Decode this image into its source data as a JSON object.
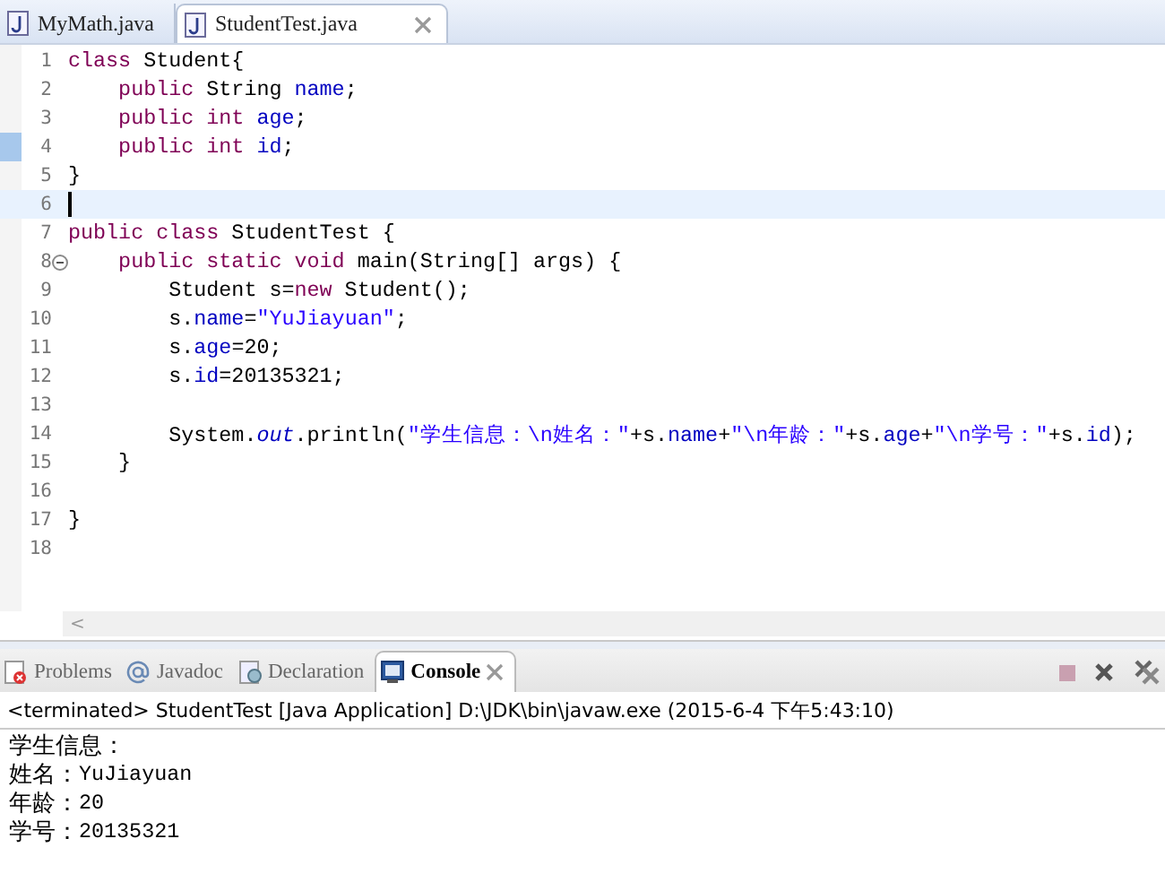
{
  "editor_tabs": [
    {
      "label": "MyMath.java",
      "selected": false,
      "closable": false
    },
    {
      "label": "StudentTest.java",
      "selected": true,
      "closable": true
    }
  ],
  "code_lines": [
    {
      "number": "1",
      "current": false,
      "marked": false,
      "foldable": false,
      "tokens": [
        {
          "kind": "keyword",
          "text": "class"
        },
        {
          "kind": "plain",
          "text": " Student{"
        }
      ]
    },
    {
      "number": "2",
      "current": false,
      "marked": false,
      "foldable": false,
      "tokens": [
        {
          "kind": "keyword",
          "text": "    public"
        },
        {
          "kind": "plain",
          "text": " String "
        },
        {
          "kind": "field",
          "text": "name"
        },
        {
          "kind": "plain",
          "text": ";"
        }
      ]
    },
    {
      "number": "3",
      "current": false,
      "marked": false,
      "foldable": false,
      "tokens": [
        {
          "kind": "keyword",
          "text": "    public int"
        },
        {
          "kind": "field",
          "text": " age"
        },
        {
          "kind": "plain",
          "text": ";"
        }
      ]
    },
    {
      "number": "4",
      "current": false,
      "marked": true,
      "foldable": false,
      "tokens": [
        {
          "kind": "keyword",
          "text": "    public int"
        },
        {
          "kind": "field",
          "text": " id"
        },
        {
          "kind": "plain",
          "text": ";"
        }
      ]
    },
    {
      "number": "5",
      "current": false,
      "marked": false,
      "foldable": false,
      "tokens": [
        {
          "kind": "plain",
          "text": "}"
        }
      ]
    },
    {
      "number": "6",
      "current": true,
      "marked": false,
      "foldable": false
    },
    {
      "number": "7",
      "current": false,
      "marked": false,
      "foldable": false,
      "tokens": [
        {
          "kind": "keyword",
          "text": "public class"
        },
        {
          "kind": "plain",
          "text": " StudentTest {"
        }
      ]
    },
    {
      "number": "8",
      "current": false,
      "marked": false,
      "foldable": true,
      "tokens": [
        {
          "kind": "keyword",
          "text": "    public static void"
        },
        {
          "kind": "plain",
          "text": " main(String[] args) {"
        }
      ]
    },
    {
      "number": "9",
      "current": false,
      "marked": false,
      "foldable": false,
      "tokens": [
        {
          "kind": "plain",
          "text": "        Student s="
        },
        {
          "kind": "keyword",
          "text": "new"
        },
        {
          "kind": "plain",
          "text": " Student();"
        }
      ]
    },
    {
      "number": "10",
      "current": false,
      "marked": false,
      "foldable": false,
      "tokens": [
        {
          "kind": "plain",
          "text": "        s."
        },
        {
          "kind": "field",
          "text": "name"
        },
        {
          "kind": "plain",
          "text": "="
        },
        {
          "kind": "string",
          "text": "\"YuJiayuan\""
        },
        {
          "kind": "plain",
          "text": ";"
        }
      ]
    },
    {
      "number": "11",
      "current": false,
      "marked": false,
      "foldable": false,
      "tokens": [
        {
          "kind": "plain",
          "text": "        s."
        },
        {
          "kind": "field",
          "text": "age"
        },
        {
          "kind": "plain",
          "text": "=20;"
        }
      ]
    },
    {
      "number": "12",
      "current": false,
      "marked": false,
      "foldable": false,
      "tokens": [
        {
          "kind": "plain",
          "text": "        s."
        },
        {
          "kind": "field",
          "text": "id"
        },
        {
          "kind": "plain",
          "text": "=20135321;"
        }
      ]
    },
    {
      "number": "13",
      "current": false,
      "marked": false,
      "foldable": false
    },
    {
      "number": "14",
      "current": false,
      "marked": false,
      "foldable": false,
      "tokens": [
        {
          "kind": "plain",
          "text": "        System."
        },
        {
          "kind": "static",
          "text": "out"
        },
        {
          "kind": "plain",
          "text": ".println("
        },
        {
          "kind": "string",
          "text": "\"学生信息：\\n姓名：\""
        },
        {
          "kind": "plain",
          "text": "+s."
        },
        {
          "kind": "field",
          "text": "name"
        },
        {
          "kind": "plain",
          "text": "+"
        },
        {
          "kind": "string",
          "text": "\"\\n年龄：\""
        },
        {
          "kind": "plain",
          "text": "+s."
        },
        {
          "kind": "field",
          "text": "age"
        },
        {
          "kind": "plain",
          "text": "+"
        },
        {
          "kind": "string",
          "text": "\"\\n学号：\""
        },
        {
          "kind": "plain",
          "text": "+s."
        },
        {
          "kind": "field",
          "text": "id"
        },
        {
          "kind": "plain",
          "text": ");"
        }
      ]
    },
    {
      "number": "15",
      "current": false,
      "marked": false,
      "foldable": false,
      "tokens": [
        {
          "kind": "plain",
          "text": "    }"
        }
      ]
    },
    {
      "number": "16",
      "current": false,
      "marked": false,
      "foldable": false
    },
    {
      "number": "17",
      "current": false,
      "marked": false,
      "foldable": false,
      "tokens": [
        {
          "kind": "plain",
          "text": "}"
        }
      ]
    },
    {
      "number": "18",
      "current": false,
      "marked": false,
      "foldable": false
    }
  ],
  "scrollbar_arrow": "<",
  "panel_tabs": [
    {
      "label": "Problems",
      "kind": "problems",
      "selected": false,
      "closable": false
    },
    {
      "label": "Javadoc",
      "kind": "javadoc",
      "selected": false,
      "closable": false
    },
    {
      "label": "Declaration",
      "kind": "declaration",
      "selected": false,
      "closable": false
    },
    {
      "label": "Console",
      "kind": "console",
      "selected": true,
      "closable": true
    }
  ],
  "console": {
    "header": "<terminated> StudentTest [Java Application] D:\\JDK\\bin\\javaw.exe (2015-6-4 下午5:43:10)",
    "output": [
      {
        "label": "学生信息："
      },
      {
        "label": "姓名：",
        "value": "YuJiayuan"
      },
      {
        "label": "年龄：",
        "value": "20"
      },
      {
        "label": "学号：",
        "value": "20135321"
      }
    ]
  }
}
